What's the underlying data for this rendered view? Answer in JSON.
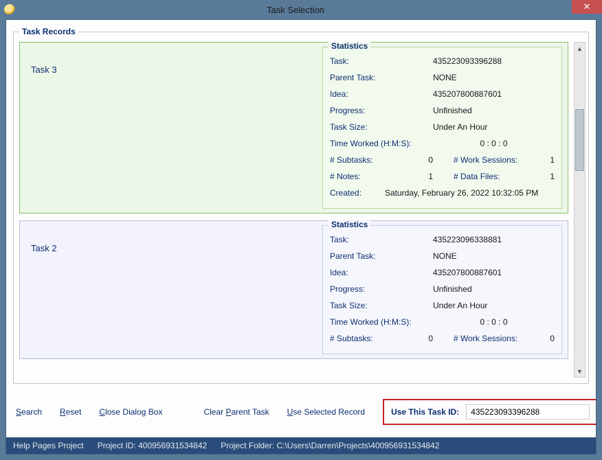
{
  "window": {
    "title": "Task Selection",
    "close_glyph": "✕"
  },
  "records_legend": "Task Records",
  "stats_legend": "Statistics",
  "labels": {
    "task": "Task:",
    "parent_task": "Parent Task:",
    "idea": "Idea:",
    "progress": "Progress:",
    "task_size": "Task Size:",
    "time_worked": "Time Worked (H:M:S):",
    "subtasks": "# Subtasks:",
    "work_sessions": "# Work Sessions:",
    "notes": "# Notes:",
    "data_files": "# Data Files:",
    "created": "Created:"
  },
  "records": [
    {
      "name": "Task 3",
      "selected": true,
      "task": "435223093396288",
      "parent_task": "NONE",
      "idea": "435207800887601",
      "progress": "Unfinished",
      "task_size": "Under An Hour",
      "time_worked": "0 : 0 : 0",
      "subtasks": "0",
      "work_sessions": "1",
      "notes": "1",
      "data_files": "1",
      "created": "Saturday, February 26, 2022   10:32:05 PM"
    },
    {
      "name": "Task 2",
      "selected": false,
      "task": "435223096338881",
      "parent_task": "NONE",
      "idea": "435207800887601",
      "progress": "Unfinished",
      "task_size": "Under An Hour",
      "time_worked": "0 : 0 : 0",
      "subtasks": "0",
      "work_sessions": "0"
    }
  ],
  "actions": {
    "search": {
      "pre": "",
      "hot": "S",
      "post": "earch"
    },
    "reset": {
      "pre": "",
      "hot": "R",
      "post": "eset"
    },
    "close": {
      "pre": "",
      "hot": "C",
      "post": "lose Dialog Box"
    },
    "clear_parent": {
      "pre": "Clear ",
      "hot": "P",
      "post": "arent Task"
    },
    "use_selected": {
      "pre": "",
      "hot": "U",
      "post": "se Selected Record"
    },
    "use_this_label": "Use This Task ID:",
    "use_this_value": "435223093396288"
  },
  "status": {
    "project_name": "Help Pages Project",
    "project_id_label": "Project ID:",
    "project_id": "400956931534842",
    "folder_label": "Project Folder:",
    "folder": "C:\\Users\\Darren\\Projects\\400956931534842"
  }
}
